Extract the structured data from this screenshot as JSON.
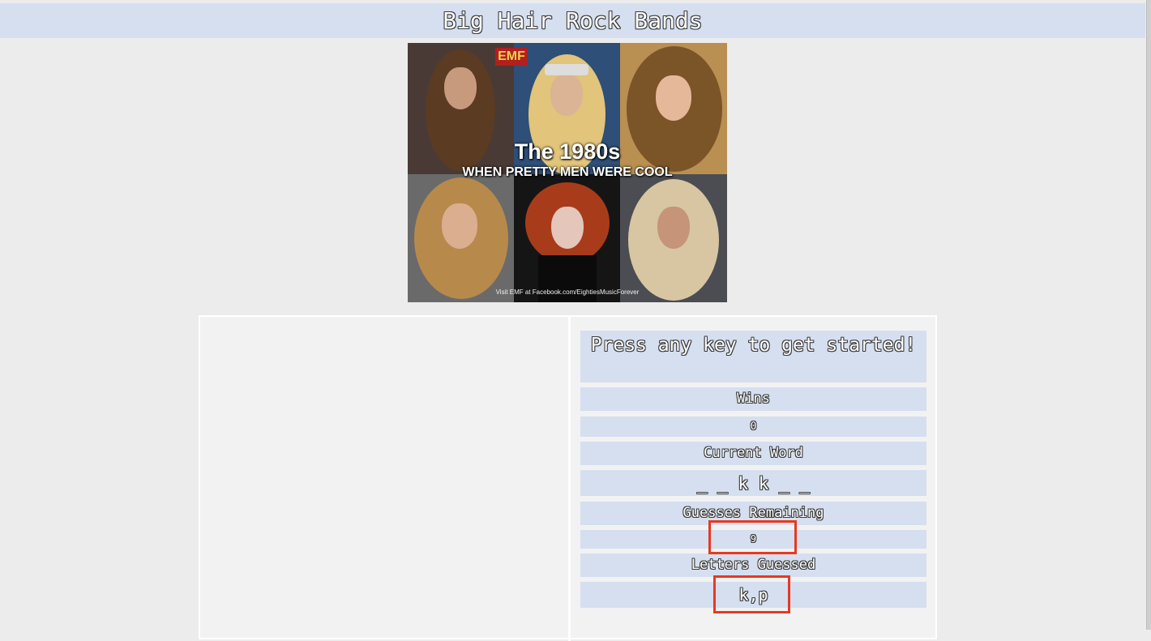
{
  "page": {
    "title": "Big Hair Rock Bands"
  },
  "hero": {
    "logo": "EMF",
    "caption_line1": "The 1980s",
    "caption_line2": "WHEN PRETTY MEN WERE COOL",
    "credit": "Visit EMF at Facebook.com/EightiesMusicForever"
  },
  "game": {
    "prompt": "Press any key to get started!",
    "wins_label": "Wins",
    "wins_value": "0",
    "current_word_label": "Current Word",
    "current_word_value": "_ _ k k _ _",
    "guesses_remaining_label": "Guesses Remaining",
    "guesses_remaining_value": "9",
    "letters_guessed_label": "Letters Guessed",
    "letters_guessed_value": "k,p"
  },
  "colors": {
    "panel_blue": "#d5dff0",
    "background": "#ececec",
    "highlight": "#e8391f"
  }
}
